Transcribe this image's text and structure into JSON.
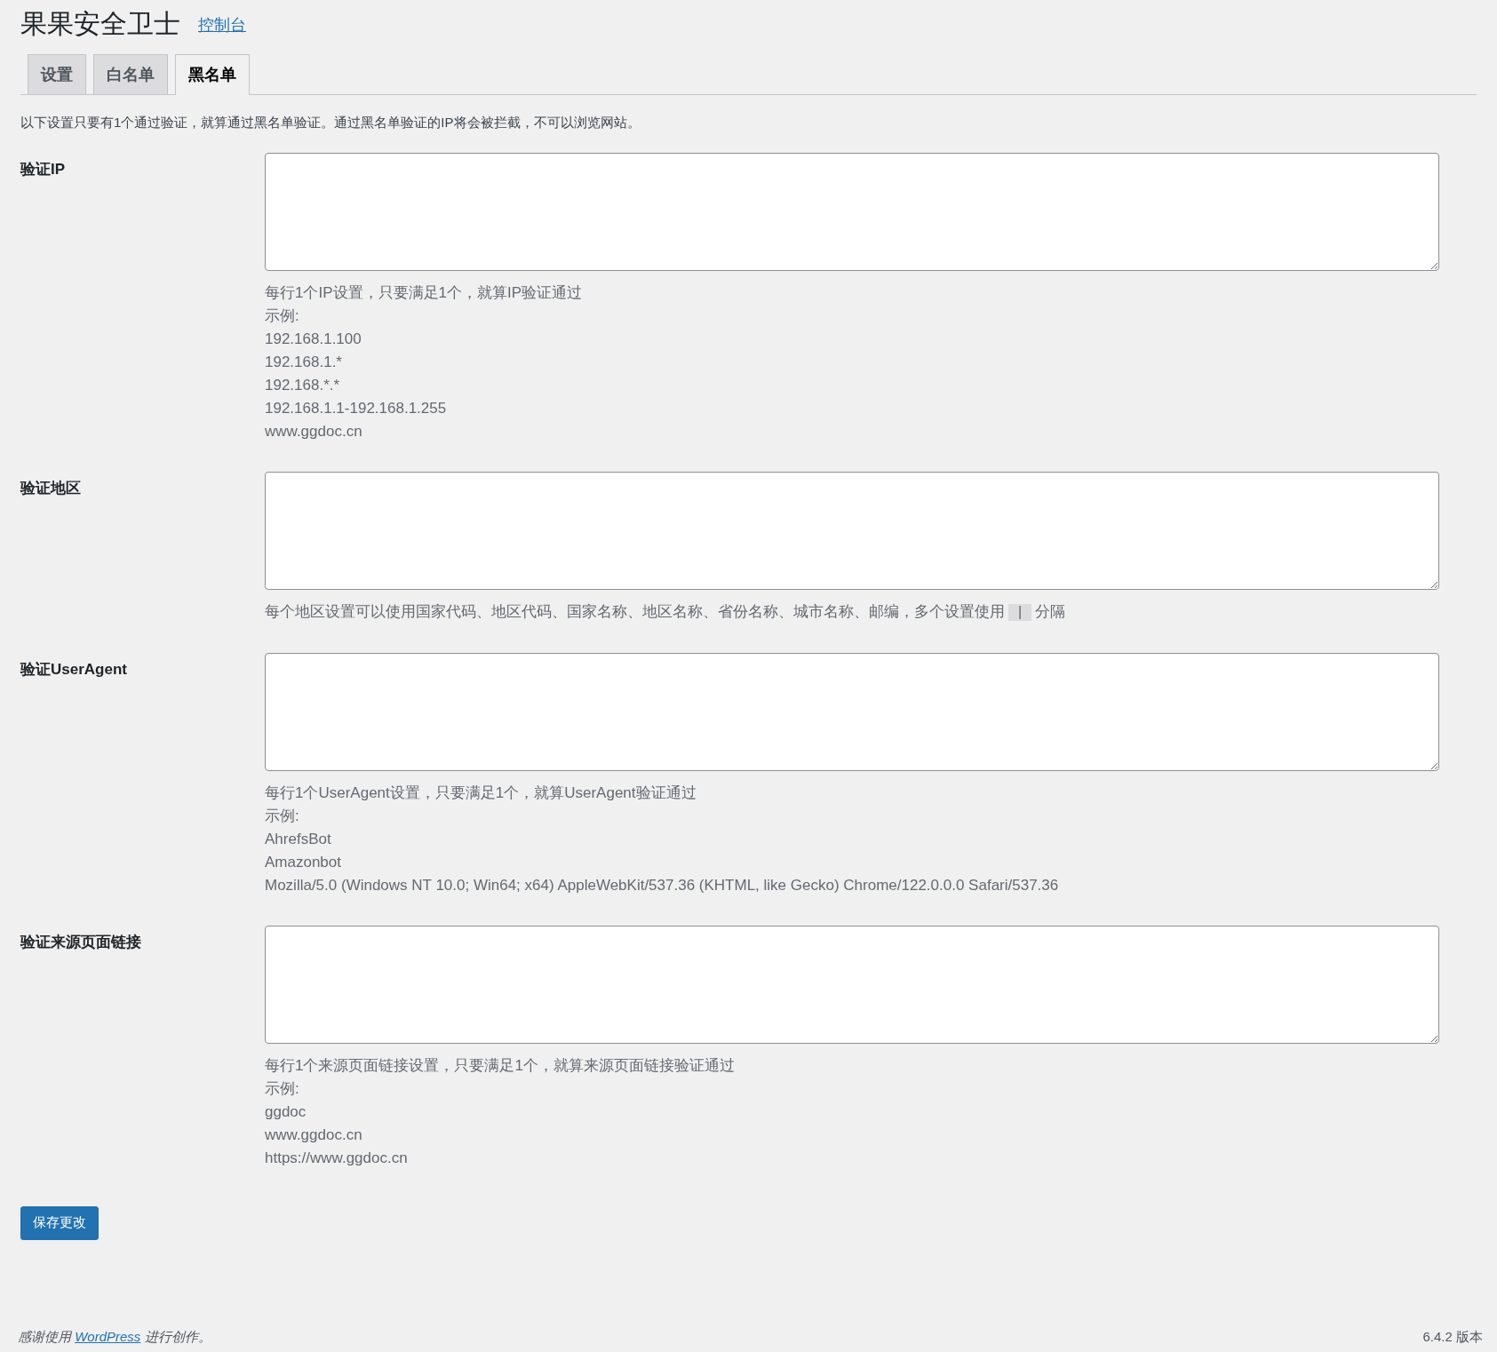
{
  "header": {
    "title": "果果安全卫士",
    "link": "控制台"
  },
  "tabs": [
    {
      "label": "设置",
      "selected": false
    },
    {
      "label": "白名单",
      "selected": false
    },
    {
      "label": "黑名单",
      "selected": true
    }
  ],
  "intro": "以下设置只要有1个通过验证，就算通过黑名单验证。通过黑名单验证的IP将会被拦截，不可以浏览网站。",
  "fields": [
    {
      "label": "验证IP",
      "lines": [
        "每行1个IP设置，只要满足1个，就算IP验证通过",
        "示例:",
        "192.168.1.100",
        "192.168.1.*",
        "192.168.*.*",
        "192.168.1.1-192.168.1.255",
        "www.ggdoc.cn"
      ]
    },
    {
      "label": "验证地区",
      "help": {
        "before": "每个地区设置可以使用国家代码、地区代码、国家名称、地区名称、省份名称、城市名称、邮编，多个设置使用",
        "code": "|",
        "after": "分隔"
      }
    },
    {
      "label": "验证UserAgent",
      "lines": [
        "每行1个UserAgent设置，只要满足1个，就算UserAgent验证通过",
        "示例:",
        "AhrefsBot",
        "Amazonbot",
        "Mozilla/5.0 (Windows NT 10.0; Win64; x64) AppleWebKit/537.36 (KHTML, like Gecko) Chrome/122.0.0.0 Safari/537.36"
      ]
    },
    {
      "label": "验证来源页面链接",
      "lines": [
        "每行1个来源页面链接设置，只要满足1个，就算来源页面链接验证通过",
        "示例:",
        "ggdoc",
        "www.ggdoc.cn",
        "https://www.ggdoc.cn"
      ]
    }
  ],
  "save_button": "保存更改",
  "footer": {
    "before": "感谢使用",
    "link": "WordPress",
    "after": "进行创作。",
    "version": "6.4.2 版本"
  }
}
